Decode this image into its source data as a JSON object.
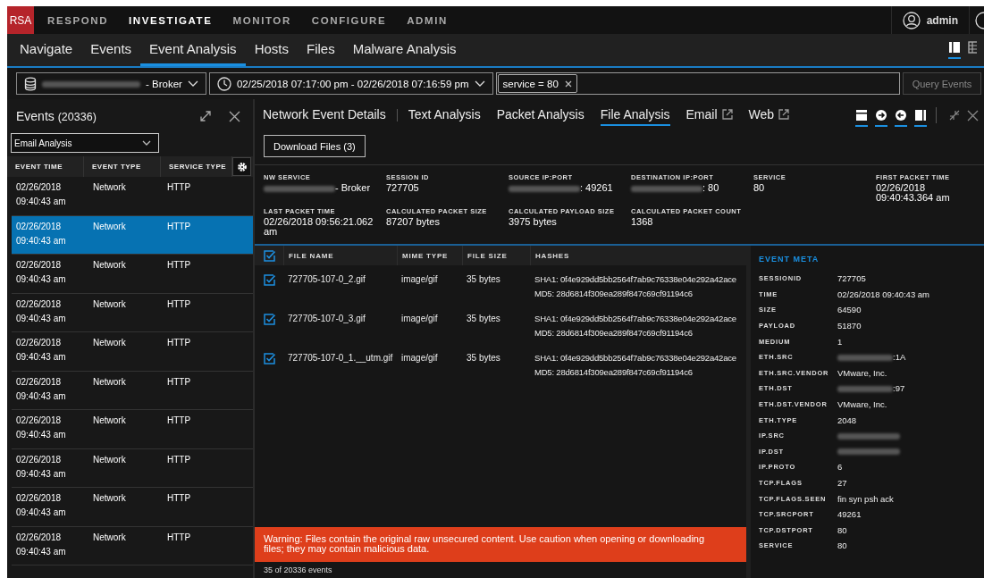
{
  "top_nav": {
    "logo": "RSA",
    "items": [
      {
        "label": "RESPOND",
        "selected": false
      },
      {
        "label": "INVESTIGATE",
        "selected": true
      },
      {
        "label": "MONITOR",
        "selected": false
      },
      {
        "label": "CONFIGURE",
        "selected": false
      },
      {
        "label": "ADMIN",
        "selected": false
      }
    ],
    "user": "admin"
  },
  "sub_nav": {
    "tabs": [
      {
        "label": "Navigate",
        "selected": false
      },
      {
        "label": "Events",
        "selected": false
      },
      {
        "label": "Event Analysis",
        "selected": true
      },
      {
        "label": "Hosts",
        "selected": false
      },
      {
        "label": "Files",
        "selected": false
      },
      {
        "label": "Malware Analysis",
        "selected": false
      }
    ]
  },
  "query_bar": {
    "service": "- Broker",
    "time_range": "02/25/2018 07:17:00 pm - 02/26/2018 07:16:59 pm",
    "filter": "service = 80",
    "button": "Query Events"
  },
  "events_panel": {
    "title": "Events",
    "count": "(20336)",
    "profile": "Email Analysis",
    "columns": [
      "EVENT TIME",
      "EVENT TYPE",
      "SERVICE TYPE"
    ],
    "rows": [
      {
        "date": "02/26/2018",
        "time": "09:40:43 am",
        "type": "Network",
        "service": "HTTP",
        "selected": false
      },
      {
        "date": "02/26/2018",
        "time": "09:40:43 am",
        "type": "Network",
        "service": "HTTP",
        "selected": true
      },
      {
        "date": "02/26/2018",
        "time": "09:40:43 am",
        "type": "Network",
        "service": "HTTP",
        "selected": false
      },
      {
        "date": "02/26/2018",
        "time": "09:40:43 am",
        "type": "Network",
        "service": "HTTP",
        "selected": false
      },
      {
        "date": "02/26/2018",
        "time": "09:40:43 am",
        "type": "Network",
        "service": "HTTP",
        "selected": false
      },
      {
        "date": "02/26/2018",
        "time": "09:40:43 am",
        "type": "Network",
        "service": "HTTP",
        "selected": false
      },
      {
        "date": "02/26/2018",
        "time": "09:40:43 am",
        "type": "Network",
        "service": "HTTP",
        "selected": false
      },
      {
        "date": "02/26/2018",
        "time": "09:40:43 am",
        "type": "Network",
        "service": "HTTP",
        "selected": false
      },
      {
        "date": "02/26/2018",
        "time": "09:40:43 am",
        "type": "Network",
        "service": "HTTP",
        "selected": false
      },
      {
        "date": "02/26/2018",
        "time": "09:40:43 am",
        "type": "Network",
        "service": "HTTP",
        "selected": false
      }
    ]
  },
  "detail": {
    "tabs": [
      {
        "label": "Network Event Details",
        "selected": false,
        "external": false
      },
      {
        "label": "Text Analysis",
        "selected": false,
        "external": false
      },
      {
        "label": "Packet Analysis",
        "selected": false,
        "external": false
      },
      {
        "label": "File Analysis",
        "selected": true,
        "external": false
      },
      {
        "label": "Email",
        "selected": false,
        "external": true
      },
      {
        "label": "Web",
        "selected": false,
        "external": true
      }
    ],
    "download_button": "Download Files (3)",
    "summary": [
      {
        "label": "NW SERVICE",
        "value": "- Broker",
        "redacted": true
      },
      {
        "label": "SESSION ID",
        "value": "727705",
        "redacted": false
      },
      {
        "label": "SOURCE IP:PORT",
        "value": ": 49261",
        "redacted": true
      },
      {
        "label": "DESTINATION IP:PORT",
        "value": ": 80",
        "redacted": true
      },
      {
        "label": "SERVICE",
        "value": "80",
        "redacted": false
      },
      {
        "label": "FIRST PACKET TIME",
        "value": "02/26/2018 09:40:43.364 am",
        "redacted": false
      },
      {
        "label": "LAST PACKET TIME",
        "value": "02/26/2018 09:56:21.062 am",
        "redacted": false
      },
      {
        "label": "CALCULATED PACKET SIZE",
        "value": "87207 bytes",
        "redacted": false
      },
      {
        "label": "CALCULATED PAYLOAD SIZE",
        "value": "3975 bytes",
        "redacted": false
      },
      {
        "label": "CALCULATED PACKET COUNT",
        "value": "1368",
        "redacted": false
      }
    ],
    "files": {
      "all_checked": true,
      "columns": [
        "FILE NAME",
        "MIME TYPE",
        "FILE SIZE",
        "HASHES"
      ],
      "rows": [
        {
          "checked": true,
          "name": "727705-107-0_2.gif",
          "mime": "image/gif",
          "size": "35 bytes",
          "sha1": "SHA1: 0f4e929dd5bb2564f7ab9c76338e04e292a42ace",
          "md5": "MD5: 28d6814f309ea289f847c69cf91194c6"
        },
        {
          "checked": true,
          "name": "727705-107-0_3.gif",
          "mime": "image/gif",
          "size": "35 bytes",
          "sha1": "SHA1: 0f4e929dd5bb2564f7ab9c76338e04e292a42ace",
          "md5": "MD5: 28d6814f309ea289f847c69cf91194c6"
        },
        {
          "checked": true,
          "name": "727705-107-0_1.__utm.gif",
          "mime": "image/gif",
          "size": "35 bytes",
          "sha1": "SHA1: 0f4e929dd5bb2564f7ab9c76338e04e292a42ace",
          "md5": "MD5: 28d6814f309ea289f847c69cf91194c6"
        }
      ]
    },
    "warning": "Warning: Files contain the original raw unsecured content. Use caution when opening or downloading files; they may contain malicious data.",
    "footer": "35 of 20336 events",
    "event_meta": {
      "title": "EVENT META",
      "rows": [
        {
          "key": "SESSIONID",
          "value": "727705",
          "redacted": false
        },
        {
          "key": "TIME",
          "value": "02/26/2018 09:40:43 am",
          "redacted": false
        },
        {
          "key": "SIZE",
          "value": "64590",
          "redacted": false
        },
        {
          "key": "PAYLOAD",
          "value": "51870",
          "redacted": false
        },
        {
          "key": "MEDIUM",
          "value": "1",
          "redacted": false
        },
        {
          "key": "ETH.SRC",
          "value": ":1A",
          "redacted": true
        },
        {
          "key": "ETH.SRC.VENDOR",
          "value": "VMware, Inc.",
          "redacted": false
        },
        {
          "key": "ETH.DST",
          "value": ":97",
          "redacted": true
        },
        {
          "key": "ETH.DST.VENDOR",
          "value": "VMware, Inc.",
          "redacted": false
        },
        {
          "key": "ETH.TYPE",
          "value": "2048",
          "redacted": false
        },
        {
          "key": "IP.SRC",
          "redacted": true
        },
        {
          "key": "IP.DST",
          "redacted": true
        },
        {
          "key": "IP.PROTO",
          "value": "6",
          "redacted": false
        },
        {
          "key": "TCP.FLAGS",
          "value": "27",
          "redacted": false
        },
        {
          "key": "TCP.FLAGS.SEEN",
          "value": "fin syn psh ack",
          "redacted": false
        },
        {
          "key": "TCP.SRCPORT",
          "value": "49261",
          "redacted": false
        },
        {
          "key": "TCP.DSTPORT",
          "value": "80",
          "redacted": false
        },
        {
          "key": "SERVICE",
          "value": "80",
          "redacted": false
        }
      ]
    }
  }
}
